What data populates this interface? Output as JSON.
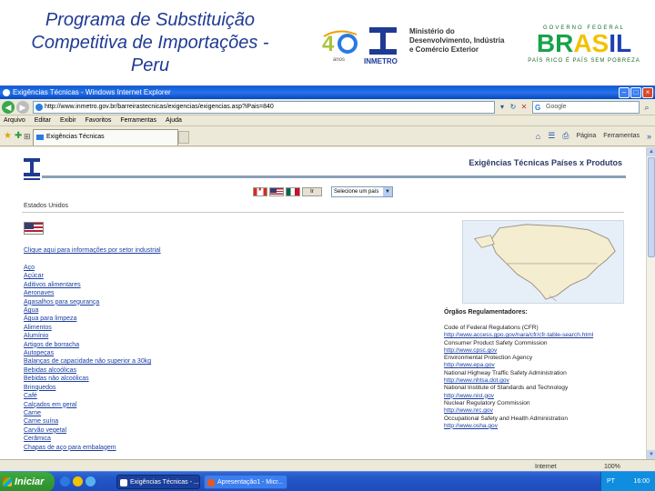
{
  "slide": {
    "title_line1": "Programa de Substituição",
    "title_line2": "Competitiva de Importações -",
    "title_line3": "Peru",
    "logo_40_text": "anos",
    "inmetro_label": "INMETRO",
    "ministry_line1": "Ministério do",
    "ministry_line2": "Desenvolvimento, Indústria",
    "ministry_line3": "e Comércio Exterior",
    "gov_top": "GOVERNO FEDERAL",
    "gov_brasil": "BRASIL",
    "gov_sub": "PAÍS RICO É PAÍS SEM POBREZA"
  },
  "browser": {
    "window_title": "Exigências Técnicas - Windows Internet Explorer",
    "url": "http://www.inmetro.gov.br/barreirastecnicas/exigencias/exigencias.asp?iPais=840",
    "search_placeholder": "Google",
    "menu": [
      "Arquivo",
      "Editar",
      "Exibir",
      "Favoritos",
      "Ferramentas",
      "Ajuda"
    ],
    "tab_label": "Exigências Técnicas",
    "cmd_home": "Página",
    "cmd_tools": "Ferramentas",
    "status_zone": "Internet",
    "status_zoom": "100%"
  },
  "webpage": {
    "header_title": "Exigências Técnicas Países x Produtos",
    "flag_go": "Ir",
    "country_select": "Selecione um país",
    "country_name": "Estados Unidos",
    "info_link": "Clique aqui para informações por setor industrial",
    "categories": [
      "Aço",
      "Açúcar",
      "Aditivos alimentares",
      "Aeronaves",
      "Agasalhos para segurança",
      "Água",
      "Água para limpeza",
      "Alimentos",
      "Alumínio",
      "Artigos de borracha",
      "Autopeças",
      "Balanças de capacidade não superior a 30kg",
      "Bebidas alcoólicas",
      "Bebidas não alcoólicas",
      "Brinquedos",
      "Café",
      "Calçados em geral",
      "Carne",
      "Carne suína",
      "Carvão vegetal",
      "Cerâmica",
      "Chapas de aço para embalagem"
    ],
    "organs_title": "Órgãos Regulamentadores:",
    "organs": [
      {
        "name": "Code of Federal Regulations (CFR)",
        "url": "http://www.access.gpo.gov/nara/cfr/cfr-table-search.html"
      },
      {
        "name": "Consumer Product Safety Commission",
        "url": "http://www.cpsc.gov"
      },
      {
        "name": "Environmental Protection Agency",
        "url": "http://www.epa.gov"
      },
      {
        "name": "National Highway Traffic Safety Administration",
        "url": "http://www.nhtsa.dot.gov"
      },
      {
        "name": "National Institute of Standards and Technology",
        "url": "http://www.nist.gov"
      },
      {
        "name": "Nuclear Regulatory Commission",
        "url": "http://www.nrc.gov"
      },
      {
        "name": "Occupational Safety and Health Administration",
        "url": "http://www.osha.gov"
      }
    ]
  },
  "taskbar": {
    "start_label": "Iniciar",
    "tasks": [
      "Exigências Técnicas - ...",
      "Apresentação1 - Micr..."
    ],
    "tray_lang": "PT",
    "tray_time": "16:00"
  },
  "colors": {
    "title_blue": "#1f3a93",
    "link_blue": "#1a3ea0",
    "xp_blue": "#2457c8",
    "start_green": "#2c8e2c"
  }
}
